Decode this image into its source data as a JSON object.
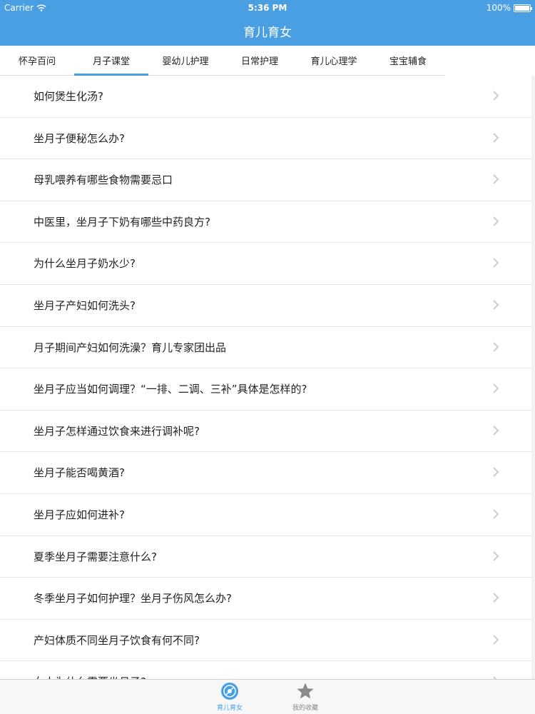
{
  "status_bar": {
    "carrier": "Carrier",
    "time": "5:36 PM",
    "battery": "100%"
  },
  "nav": {
    "title": "育儿育女"
  },
  "tabs": [
    {
      "label": "怀孕百问"
    },
    {
      "label": "月子课堂"
    },
    {
      "label": "婴幼儿护理"
    },
    {
      "label": "日常护理"
    },
    {
      "label": "育儿心理学"
    },
    {
      "label": "宝宝辅食"
    }
  ],
  "active_tab": "月子课堂",
  "items": [
    {
      "label": "如何煲生化汤?"
    },
    {
      "label": "坐月子便秘怎么办?"
    },
    {
      "label": "母乳喂养有哪些食物需要忌口"
    },
    {
      "label": "中医里，坐月子下奶有哪些中药良方?"
    },
    {
      "label": "为什么坐月子奶水少?"
    },
    {
      "label": "坐月子产妇如何洗头?"
    },
    {
      "label": "月子期间产妇如何洗澡？育儿专家团出品"
    },
    {
      "label": "坐月子应当如何调理？“一排、二调、三补”具体是怎样的?"
    },
    {
      "label": "坐月子怎样通过饮食来进行调补呢?"
    },
    {
      "label": "坐月子能否喝黄酒?"
    },
    {
      "label": "坐月子应如何进补?"
    },
    {
      "label": "夏季坐月子需要注意什么?"
    },
    {
      "label": "冬季坐月子如何护理？坐月子伤风怎么办?"
    },
    {
      "label": "产妇体质不同坐月子饮食有何不同?"
    },
    {
      "label": "女人为什么需要坐月子?"
    }
  ],
  "tabbar": {
    "home_label": "育儿育女",
    "home_icon": "disc-icon",
    "favorites_label": "我的收藏",
    "favorites_icon": "star-icon"
  },
  "colors": {
    "accent": "#4a9fe3",
    "separator": "#e5e5e5",
    "chevron": "#c7c7cc"
  }
}
